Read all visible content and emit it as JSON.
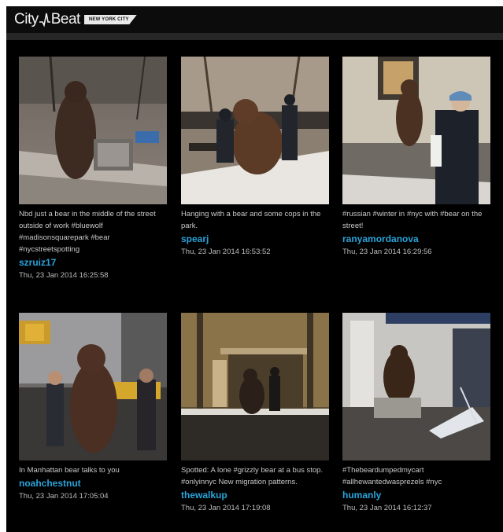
{
  "header": {
    "logo_left": "City",
    "logo_right": "Beat",
    "city_tag": "NEW YORK CITY"
  },
  "posts": [
    {
      "caption": "Nbd just a bear in the middle of the street outside of work #bluewolf #madisonsquarepark #bear #nycstreetspotting",
      "user": "szruiz17",
      "time": "Thu, 23 Jan 2014 16:25:58"
    },
    {
      "caption": "Hanging with a bear and some cops in the park.",
      "user": "spearj",
      "time": "Thu, 23 Jan 2014 16:53:52"
    },
    {
      "caption": "#russian #winter in #nyc with #bear on the street!",
      "user": "ranyamordanova",
      "time": "Thu, 23 Jan 2014 16:29:56"
    },
    {
      "caption": "In Manhattan bear talks to you",
      "user": "noahchestnut",
      "time": "Thu, 23 Jan 2014 17:05:04"
    },
    {
      "caption": "Spotted: A lone #grizzly bear at a bus stop. #onlyinnyc New migration patterns.",
      "user": "thewalkup",
      "time": "Thu, 23 Jan 2014 17:19:08"
    },
    {
      "caption": "#Thebeardumpedmycart #allhewantedwasprezels #nyc",
      "user": "humanly",
      "time": "Thu, 23 Jan 2014 16:12:37"
    }
  ]
}
